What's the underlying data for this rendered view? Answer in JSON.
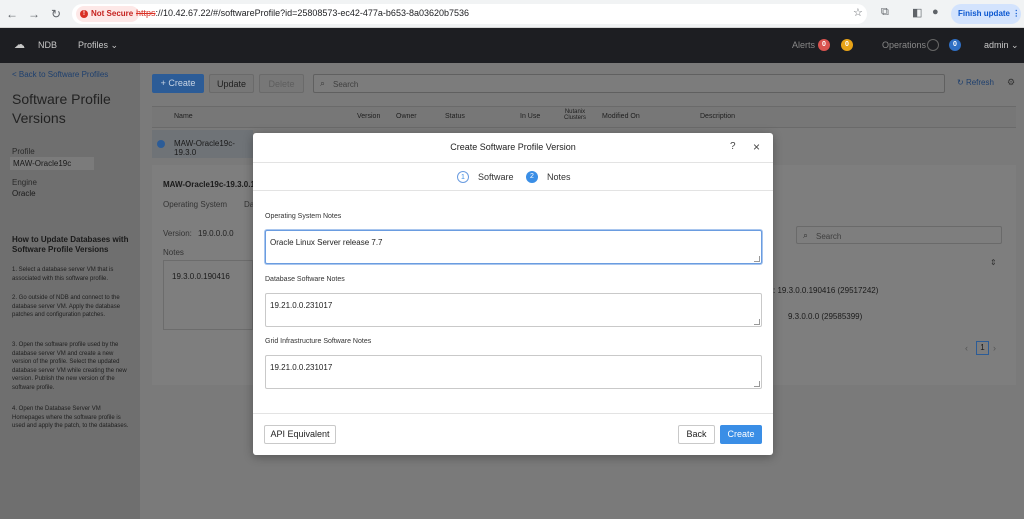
{
  "browser": {
    "security_label": "Not Secure",
    "url_scheme": "https",
    "url_rest": "://10.42.67.22/#/softwareProfile?id=25808573-ec42-477a-b653-8a03620b7536",
    "finish_update": "Finish update"
  },
  "appbar": {
    "brand": "NDB",
    "menu": "Profiles",
    "alerts_label": "Alerts",
    "alerts_red": "0",
    "alerts_yellow": "0",
    "operations_label": "Operations",
    "operations_count": "0",
    "user": "admin"
  },
  "sidebar": {
    "back_link": "< Back to Software Profiles",
    "title_line1": "Software Profile",
    "title_line2": "Versions",
    "profile_label": "Profile",
    "profile_value": "MAW-Oracle19c",
    "engine_label": "Engine",
    "engine_value": "Oracle",
    "help_title_line1": "How to Update Databases with",
    "help_title_line2": "Software Profile Versions",
    "steps": [
      "1. Select a database server VM that is associated with this software profile.",
      "2. Go outside of NDB and connect to the database server VM. Apply the database patches and configuration patches.",
      "3. Open the software profile used by the database server VM and create a new version of the profile. Select the updated database server VM while creating the new version. Publish the new version of the software profile.",
      "4. Open the Database Server VM Homepages where the software profile is used and apply the patch, to the databases."
    ]
  },
  "toolbar": {
    "create": "+ Create",
    "update": "Update",
    "delete": "Delete",
    "search_placeholder": "Search",
    "refresh": "Refresh"
  },
  "table": {
    "columns": [
      "Name",
      "Version",
      "Owner",
      "Status",
      "In Use",
      "Nutanix Clusters",
      "Modified On",
      "Description"
    ],
    "row_name": "MAW-Oracle19c-19.3.0"
  },
  "detail": {
    "title": "MAW-Oracle19c-19.3.0.1",
    "tab_os": "Operating System",
    "tab_db": "Da",
    "version_label": "Version:",
    "version_value": "19.0.0.0.0",
    "notes_label": "Notes",
    "notes_value": "19.3.0.0.190416",
    "search_placeholder": "Search",
    "patch1": ": 19.3.0.0.190416 (29517242)",
    "patch2": "9.3.0.0.0 (29585399)",
    "page": "1"
  },
  "modal": {
    "title": "Create Software Profile Version",
    "help": "?",
    "close": "×",
    "step1_num": "1",
    "step1_label": "Software",
    "step2_num": "2",
    "step2_label": "Notes",
    "os_notes_label": "Operating System Notes",
    "os_notes_value": "Oracle Linux Server release 7.7",
    "db_notes_label": "Database Software Notes",
    "db_notes_value": "19.21.0.0.231017",
    "grid_notes_label": "Grid Infrastructure Software Notes",
    "grid_notes_value": "19.21.0.0.231017",
    "api_button": "API Equivalent",
    "back_button": "Back",
    "create_button": "Create"
  },
  "colors": {
    "primary": "#3a8ee6",
    "header_bg": "#1d1e22",
    "overlay": "#7a7a7a"
  }
}
